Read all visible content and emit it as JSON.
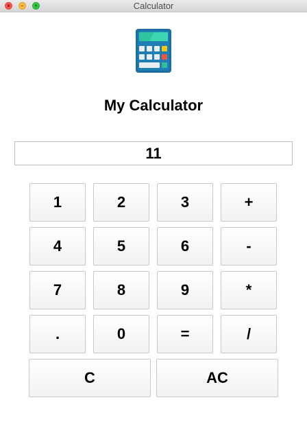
{
  "window": {
    "title": "Calculator"
  },
  "app": {
    "heading": "My Calculator",
    "icon": "calculator-icon"
  },
  "display": {
    "value": "11"
  },
  "keypad": {
    "row1": [
      "1",
      "2",
      "3",
      "+"
    ],
    "row2": [
      "4",
      "5",
      "6",
      "-"
    ],
    "row3": [
      "7",
      "8",
      "9",
      "*"
    ],
    "row4": [
      ".",
      "0",
      "=",
      "/"
    ],
    "clear": "C",
    "all_clear": "AC"
  },
  "colors": {
    "icon_body": "#1a6fa0",
    "icon_screen": "#2ec4a0",
    "icon_key": "#e8eef3",
    "icon_accent_yellow": "#f5c518",
    "icon_accent_red": "#e9573f",
    "icon_accent_green": "#37bc9b"
  }
}
